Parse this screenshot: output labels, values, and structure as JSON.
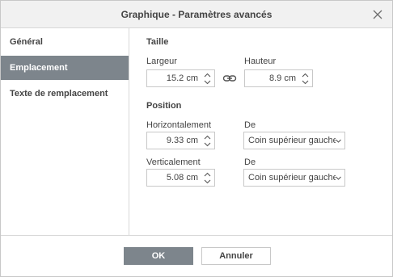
{
  "dialog": {
    "title": "Graphique - Paramètres avancés"
  },
  "sidebar": {
    "items": [
      {
        "label": "Général",
        "active": false
      },
      {
        "label": "Emplacement",
        "active": true
      },
      {
        "label": "Texte de remplacement",
        "active": false
      }
    ]
  },
  "size": {
    "section_label": "Taille",
    "width_label": "Largeur",
    "width_value": "15.2 cm",
    "height_label": "Hauteur",
    "height_value": "8.9 cm"
  },
  "position": {
    "section_label": "Position",
    "horizontal_label": "Horizontalement",
    "horizontal_value": "9.33 cm",
    "horizontal_from_label": "De",
    "horizontal_from_value": "Coin supérieur gauche",
    "vertical_label": "Verticalement",
    "vertical_value": "5.08 cm",
    "vertical_from_label": "De",
    "vertical_from_value": "Coin supérieur gauche"
  },
  "footer": {
    "ok_label": "OK",
    "cancel_label": "Annuler"
  },
  "icons": {
    "close": "close-icon",
    "link": "link-icon",
    "spin_up": "chevron-up-icon",
    "spin_down": "chevron-down-icon",
    "dropdown": "chevron-down-icon"
  },
  "colors": {
    "active_background": "#7d858c",
    "title_bar_background": "#f1f1f1",
    "border": "#c8c8c8"
  }
}
